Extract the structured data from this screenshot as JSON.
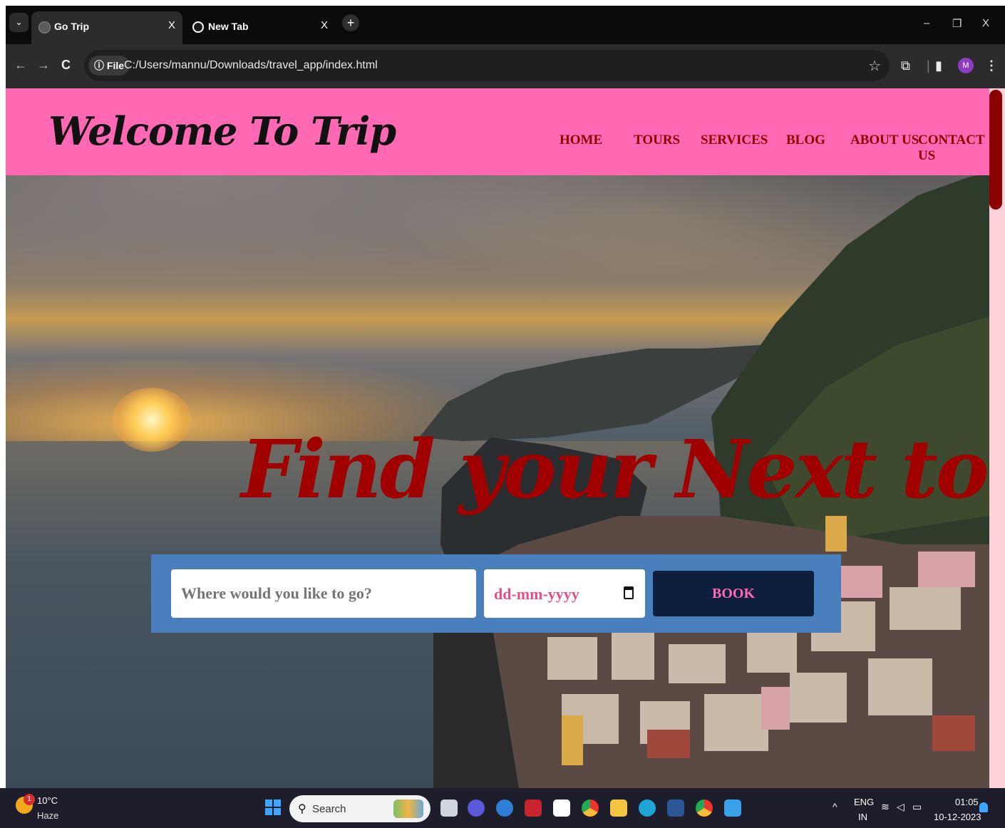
{
  "browser": {
    "tabs": [
      {
        "title": "Go Trip",
        "close": "X",
        "active": true
      },
      {
        "title": "New Tab",
        "close": "X",
        "active": false
      }
    ],
    "new_tab": "+",
    "tab_menu": "⌄",
    "window": {
      "minimize": "–",
      "restore": "❐",
      "close": "X"
    },
    "nav": {
      "back": "←",
      "forward": "→",
      "reload": "C"
    },
    "site_chip": "ⓘ File",
    "url": "C:/Users/mannu/Downloads/travel_app/index.html",
    "bookmark_star": "☆",
    "profile_initial": "M"
  },
  "site": {
    "logo": "Welcome To Trip",
    "nav": [
      "HOME",
      "TOURS",
      "SERVICES",
      "BLOG",
      "ABOUT US",
      "CONTACT US"
    ],
    "headline": "Find your Next tour!",
    "booking": {
      "destination_placeholder": "Where would you like to go?",
      "date_placeholder": "dd-mm-yyyy",
      "button": "BOOK"
    }
  },
  "taskbar": {
    "weather": {
      "badge": "1",
      "temp": "10°C",
      "desc": "Haze"
    },
    "search_placeholder": "Search",
    "tray": {
      "chevron": "^",
      "lang": "ENG",
      "region": "IN",
      "time": "01:05",
      "date": "10-12-2023"
    }
  },
  "colors": {
    "header": "#ff69b4",
    "nav_text": "#8b0000",
    "headline": "#a10000",
    "booking_bar": "#4a7fbd",
    "book_button": "#0d1f3c"
  }
}
